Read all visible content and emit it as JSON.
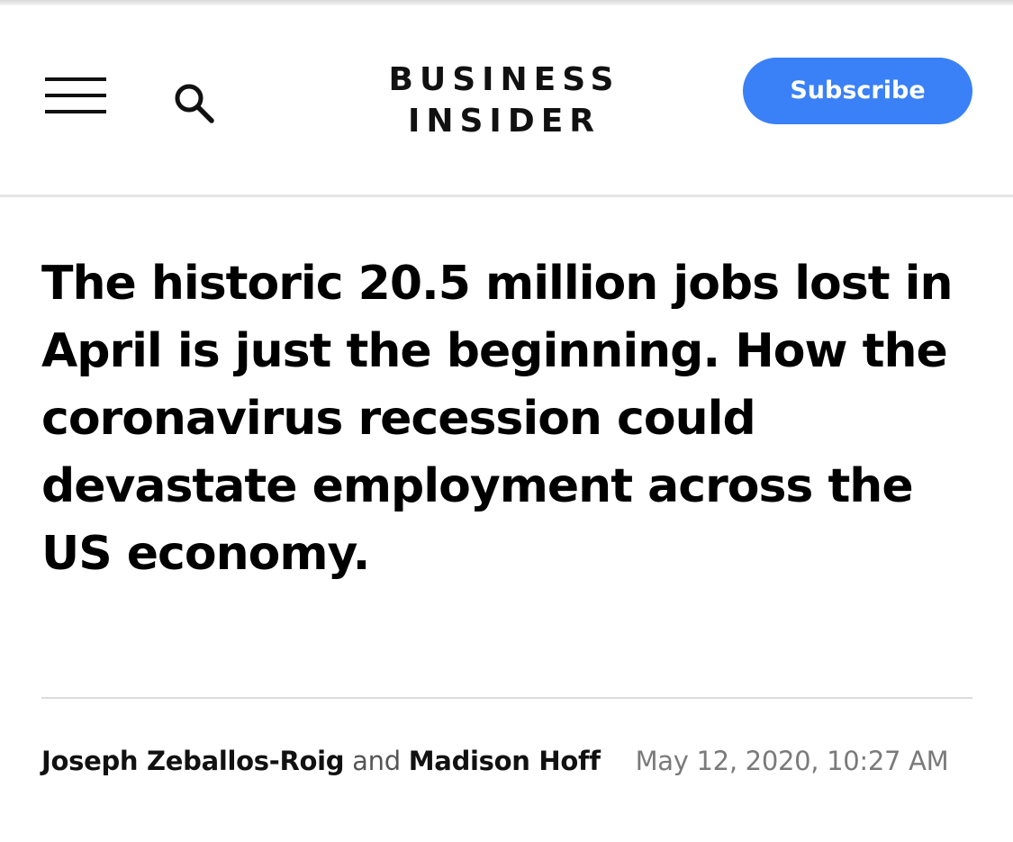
{
  "header": {
    "menu_icon": "hamburger-menu-icon",
    "search_icon": "search-icon",
    "logo_line1": "BUSINESS",
    "logo_line2": "INSIDER",
    "subscribe_label": "Subscribe",
    "subscribe_color": "#3a80f6"
  },
  "article": {
    "headline": "The historic 20.5 million jobs lost in April is just the beginning. How the coronavirus recession could devastate employment across the US economy.",
    "byline": {
      "author1": "Joseph Zeballos-Roig",
      "joiner": "and",
      "author2": "Madison Hoff",
      "timestamp": "May 12, 2020, 10:27 AM"
    }
  }
}
